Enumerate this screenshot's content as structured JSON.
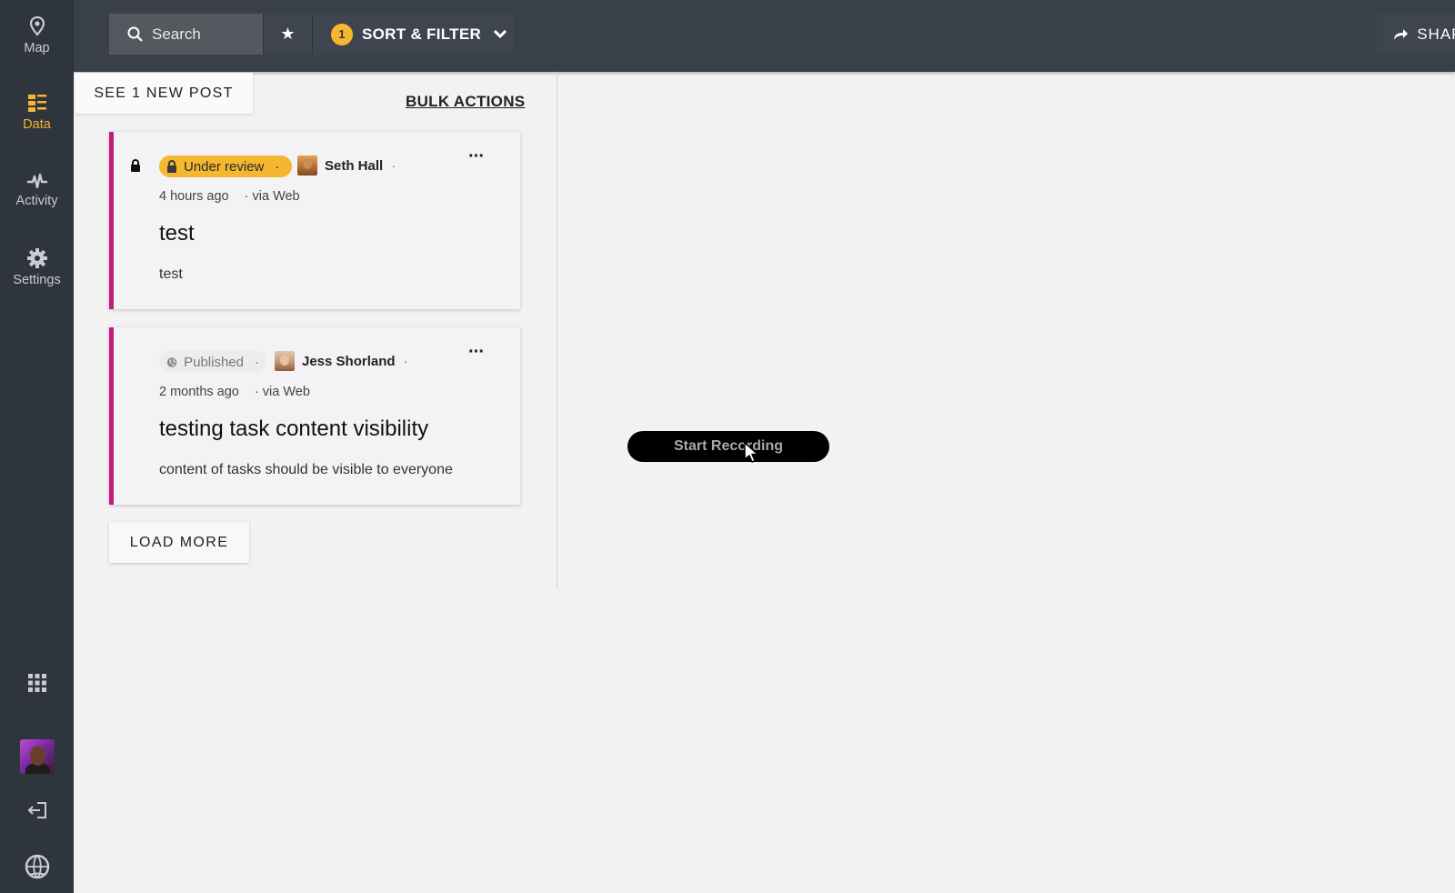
{
  "nav": {
    "items": [
      {
        "label": "Map",
        "icon": "map-pin-icon"
      },
      {
        "label": "Data",
        "icon": "data-list-icon",
        "active": true
      },
      {
        "label": "Activity",
        "icon": "activity-pulse-icon"
      },
      {
        "label": "Settings",
        "icon": "gear-icon"
      }
    ],
    "bottom_icons": [
      "apps-grid-icon",
      "avatar",
      "logout-icon",
      "globe-logo-icon"
    ]
  },
  "topbar": {
    "search_label": "Search",
    "filter_count": "1",
    "sort_filter_label": "SORT & FILTER",
    "share_label": "SHARE"
  },
  "feed": {
    "new_post_label": "SEE 1 NEW POST",
    "bulk_actions_label": "BULK ACTIONS",
    "load_more_label": "LOAD MORE",
    "posts": [
      {
        "status": "Under review",
        "author": "Seth Hall",
        "time": "4 hours ago",
        "source": "via Web",
        "title": "test",
        "body": "test"
      },
      {
        "status": "Published",
        "author": "Jess Shorland",
        "time": "2 months ago",
        "source": "via Web",
        "title": "testing task content visibility",
        "body": "content of tasks should be visible to everyone"
      }
    ]
  },
  "recording": {
    "label": "Start Recording"
  },
  "colors": {
    "sidebar_bg": "#2f353d",
    "topbar_bg": "#394049",
    "accent": "#f5b730",
    "card_border": "#c8197d",
    "page_bg": "#f2f2f3"
  }
}
